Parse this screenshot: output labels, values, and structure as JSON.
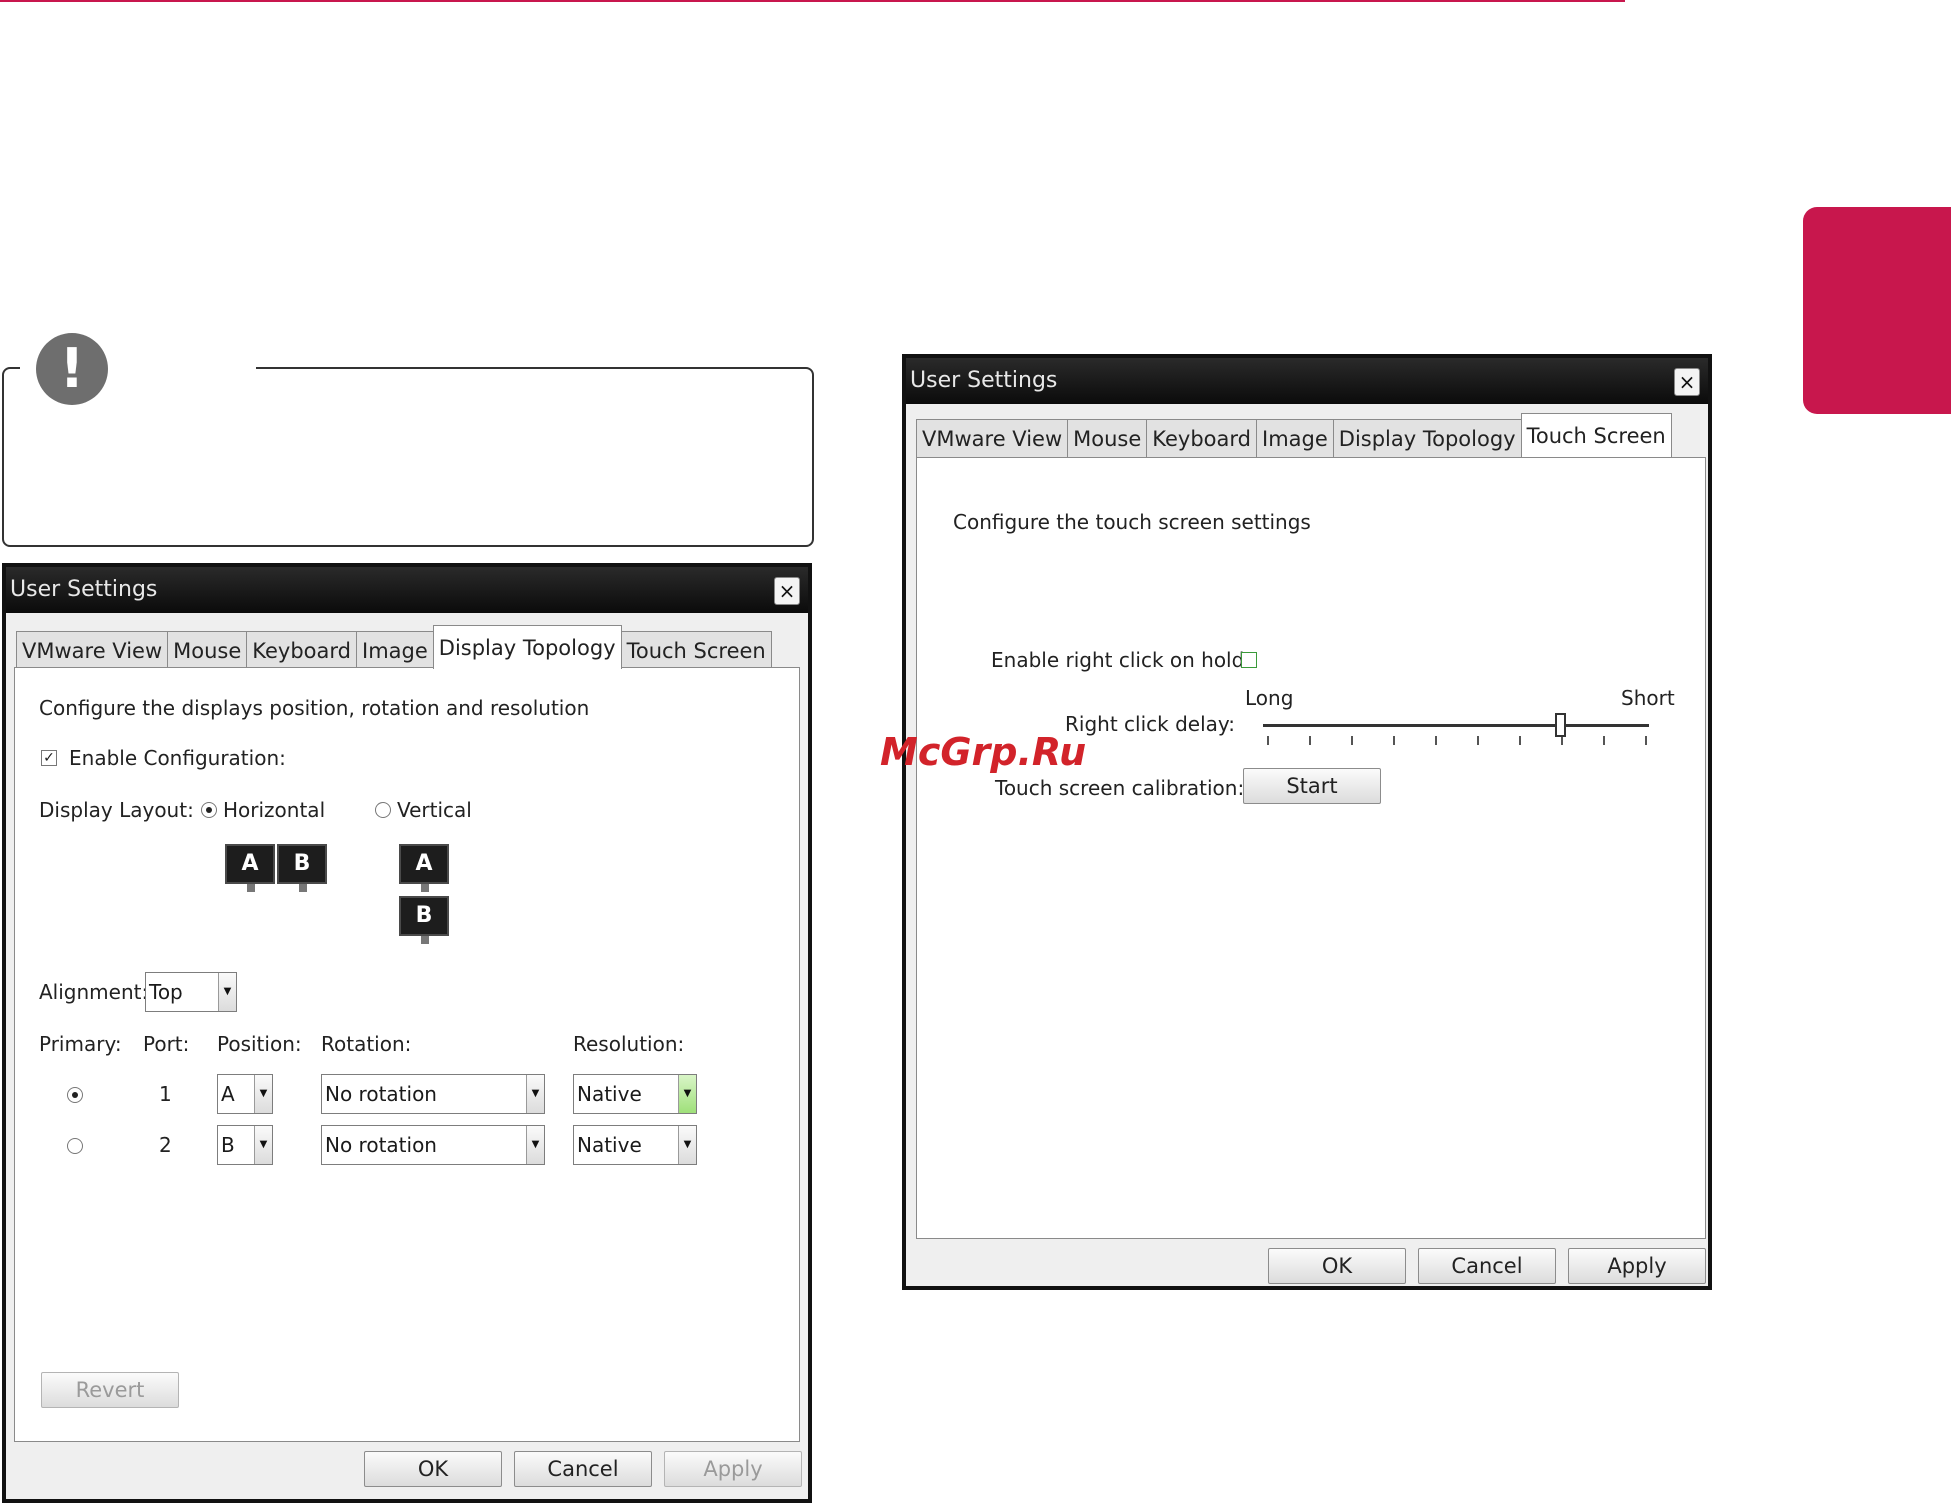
{
  "page": {
    "watermark": "McGrp.Ru",
    "note_icon": "!"
  },
  "left_window": {
    "title": "User Settings",
    "close": "×",
    "tabs": [
      "VMware View",
      "Mouse",
      "Keyboard",
      "Image",
      "Display Topology",
      "Touch Screen"
    ],
    "active_tab": "Display Topology",
    "description": "Configure the displays position, rotation and resolution",
    "enable_configuration": {
      "label": "Enable Configuration:",
      "checked": true,
      "mark": "✓"
    },
    "display_layout": {
      "label": "Display Layout:",
      "horizontal": "Horizontal",
      "vertical": "Vertical",
      "selected": "Horizontal",
      "monitor_a": "A",
      "monitor_b": "B"
    },
    "alignment": {
      "label": "Alignment:",
      "value": "Top"
    },
    "columns": {
      "primary": "Primary:",
      "port": "Port:",
      "position": "Position:",
      "rotation": "Rotation:",
      "resolution": "Resolution:"
    },
    "rows": [
      {
        "primary": true,
        "port": "1",
        "position": "A",
        "rotation": "No rotation",
        "resolution": "Native"
      },
      {
        "primary": false,
        "port": "2",
        "position": "B",
        "rotation": "No rotation",
        "resolution": "Native"
      }
    ],
    "arrow": "▼",
    "buttons": {
      "revert": "Revert",
      "ok": "OK",
      "cancel": "Cancel",
      "apply": "Apply"
    }
  },
  "right_window": {
    "title": "User Settings",
    "close": "×",
    "tabs": [
      "VMware View",
      "Mouse",
      "Keyboard",
      "Image",
      "Display Topology",
      "Touch Screen"
    ],
    "active_tab": "Touch Screen",
    "description": "Configure the touch screen settings",
    "enable_right_click": {
      "label": "Enable right click on hold:",
      "checked": false
    },
    "right_click_delay": {
      "label": "Right click delay:",
      "min_label": "Long",
      "max_label": "Short",
      "value_fraction": 0.77
    },
    "calibration": {
      "label": "Touch screen calibration:",
      "button": "Start"
    },
    "buttons": {
      "ok": "OK",
      "cancel": "Cancel",
      "apply": "Apply"
    }
  },
  "colors": {
    "accent": "#c8174d",
    "watermark": "#d2232a",
    "titlebar": "#111111"
  }
}
